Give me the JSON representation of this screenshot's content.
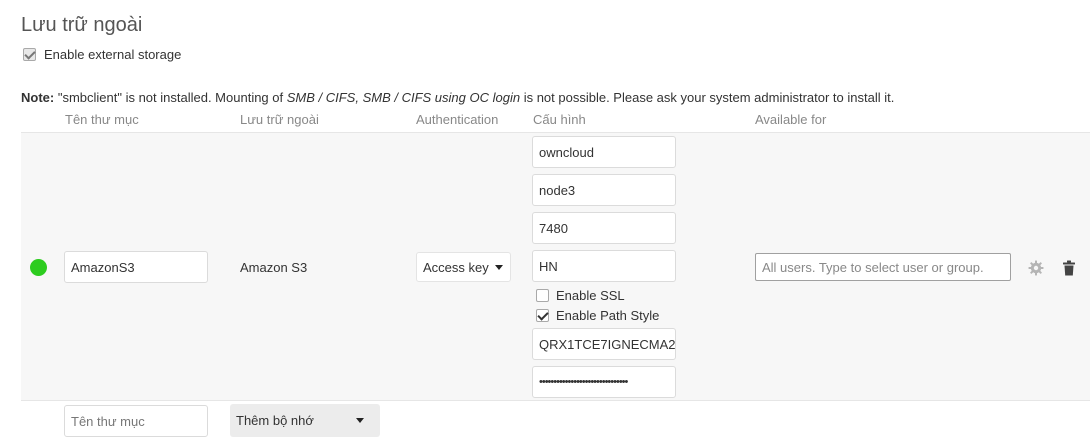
{
  "section": {
    "title": "Lưu trữ ngoài",
    "enable_label": "Enable external storage",
    "enable_checked": true
  },
  "note": {
    "prefix": "Note:",
    "text_1": " \"smbclient\" is not installed. Mounting of ",
    "backends": "SMB / CIFS, SMB / CIFS using OC login",
    "text_2": " is not possible. Please ask your system administrator to install it."
  },
  "table": {
    "headers": {
      "folder": "Tên thư mục",
      "storage": "Lưu trữ ngoài",
      "authentication": "Authentication",
      "config": "Cấu hình",
      "available_for": "Available for"
    }
  },
  "mount": {
    "status_color": "#2dcc1f",
    "folder_name": "AmazonS3",
    "storage_type": "Amazon S3",
    "auth_method": "Access key",
    "config": {
      "bucket": "owncloud",
      "hostname": "node3",
      "port": "7480",
      "region": "HN",
      "enable_ssl_label": "Enable SSL",
      "enable_ssl_checked": false,
      "path_style_label": "Enable Path Style",
      "path_style_checked": true,
      "access_key": "QRX1TCE7IGNECMA2",
      "secret_key": "•••••••••••••••••••••••••••••••"
    },
    "applicable_placeholder": "All users. Type to select user or group.",
    "actions": [
      "gear-icon",
      "trash-icon"
    ]
  },
  "new_row": {
    "folder_placeholder": "Tên thư mục",
    "add_storage_label": "Thêm bộ nhớ"
  }
}
